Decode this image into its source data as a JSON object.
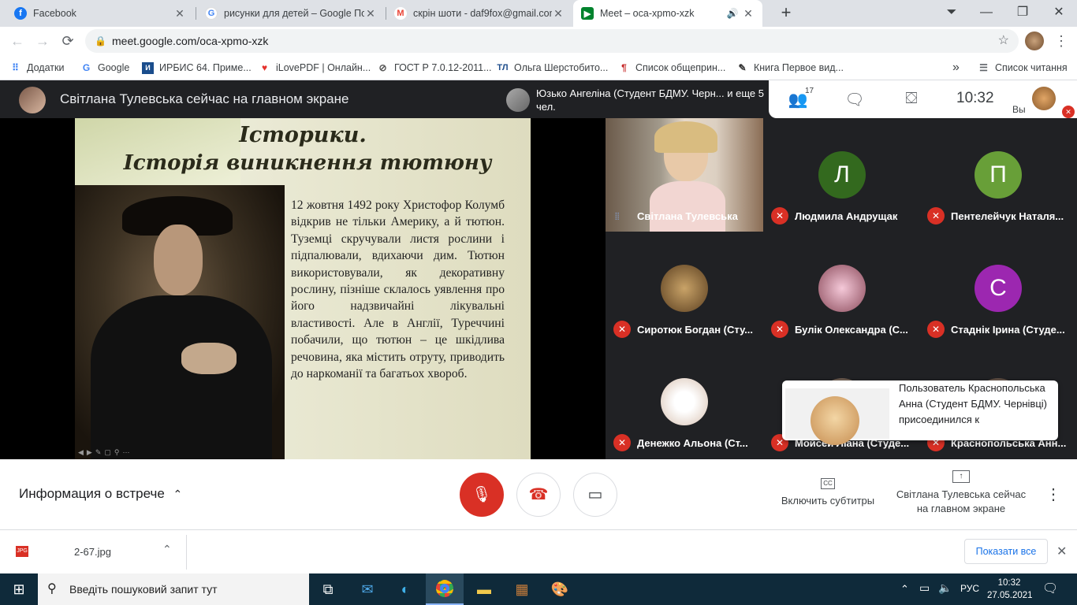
{
  "tabs": [
    {
      "title": "Facebook",
      "icon": "facebook-icon"
    },
    {
      "title": "рисунки для детей – Google По",
      "icon": "google-icon"
    },
    {
      "title": "скрін шоти - daf9fox@gmail.com",
      "icon": "gmail-icon"
    },
    {
      "title": "Meet – oca-xpmo-xzk",
      "icon": "meet-icon"
    }
  ],
  "address": "meet.google.com/oca-xpmo-xzk",
  "bookmarks": [
    {
      "label": "Додатки"
    },
    {
      "label": "Google"
    },
    {
      "label": "ИРБИС 64. Приме..."
    },
    {
      "label": "iLovePDF | Онлайн..."
    },
    {
      "label": "ГОСТ Р 7.0.12-2011..."
    },
    {
      "label": "Ольга Шерстобито..."
    },
    {
      "label": "Список общеприн..."
    },
    {
      "label": "Книга Первое вид..."
    }
  ],
  "reading_list": "Список читання",
  "meet": {
    "presenter_title": "Світлана Тулевська сейчас на главном экране",
    "notification": "Юзько Ангеліна (Студент БДМУ. Черн... и еще 5 чел.",
    "participants_count": "17",
    "clock": "10:32",
    "you_label": "Вы"
  },
  "slide": {
    "title1": "Історики.",
    "title2": "Історія виникнення тютюну",
    "body": "12 жовтня 1492 року Христофор Колумб відкрив не тільки Америку, а й тютюн. Туземці скручували листя рослини і підпалювали, вдихаючи дим. Тютюн використовували, як декоративну рослину, пізніше склалось уявлення про його надзвичайні лікувальні властивості. Але в Англії, Туреччині побачили, що тютюн – це шкідлива речовина, яка містить отруту, приводить до наркоманії та багатьох хвороб."
  },
  "participants": [
    {
      "name": "Світлана Тулевська",
      "type": "video"
    },
    {
      "name": "Людмила Андрущак",
      "letter": "Л",
      "color": "#33691e"
    },
    {
      "name": "Пентелейчук Наталя...",
      "letter": "П",
      "color": "#689f38"
    },
    {
      "name": "Сиротюк Богдан (Сту...",
      "type": "photo"
    },
    {
      "name": "Булік Олександра (С...",
      "type": "photo"
    },
    {
      "name": "Стаднік Ірина (Студе...",
      "letter": "С",
      "color": "#9c27b0"
    },
    {
      "name": "Денежко Альона (Ст...",
      "type": "photo"
    },
    {
      "name": "Мойсей Ліана (Студе...",
      "type": "photo"
    },
    {
      "name": "Краснопольська Анн...",
      "type": "photo"
    }
  ],
  "toast": "Пользователь Краснопольська Анна (Студент БДМУ. Чернівці) присоединился к",
  "controls": {
    "meeting_info": "Информация о встрече",
    "captions": "Включить субтитры",
    "present": "Світлана Тулевська сейчас на главном экране"
  },
  "download": {
    "file": "2-67.jpg",
    "show_all": "Показати все"
  },
  "taskbar": {
    "search_placeholder": "Введіть пошуковий запит тут",
    "lang": "РУС",
    "time": "10:32",
    "date": "27.05.2021"
  }
}
